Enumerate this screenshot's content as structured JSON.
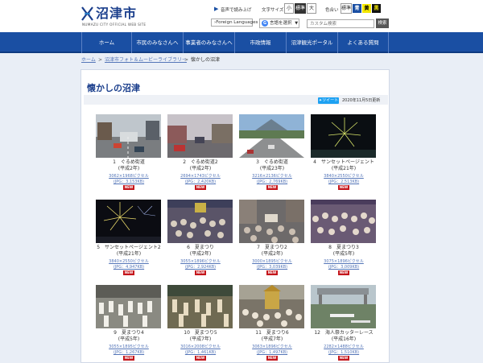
{
  "header": {
    "logo_name": "沼津市",
    "logo_sub": "NUMAZU CITY OFFICIAL WEB SITE",
    "read_aloud": "音声で読み上げ",
    "font_size_label": "文字サイズ",
    "font_small": "小",
    "font_standard": "標準",
    "font_large": "大",
    "color_label": "色合い",
    "color_standard": "標準",
    "color_blue": "青",
    "color_yellow": "黄",
    "color_black": "黒",
    "foreign_languages": "›Foreign Languages",
    "language_select": "言語を選択",
    "search_placeholder": "カスタム検索",
    "search_button": "検索"
  },
  "nav": [
    {
      "label": "ホーム"
    },
    {
      "label": "市民のみなさんへ"
    },
    {
      "label": "事業者のみなさんへ"
    },
    {
      "label": "市政情報"
    },
    {
      "label": "沼津観光ポータル"
    },
    {
      "label": "よくある質問"
    }
  ],
  "breadcrumb": {
    "home": "ホーム",
    "sep1": ">",
    "library": "沼津市フォト＆ムービーライブラリー",
    "sep2": ">",
    "current": "懐かしの沼津"
  },
  "page": {
    "title": "懐かしの沼津",
    "tweet": "ツイート",
    "date": "2020年11月5日更新"
  },
  "photos": [
    {
      "title": "1　ぐるめ街道",
      "era": "(平成2年)",
      "dim": "3062×1968ピクセル",
      "file": "(JPG：3,153KB)",
      "badge": "NEW",
      "scene": "street"
    },
    {
      "title": "2　ぐるめ街道2",
      "era": "(平成2年)",
      "dim": "2694×1743ピクセル",
      "file": "(JPG：2,420KB)",
      "badge": "NEW",
      "scene": "street2"
    },
    {
      "title": "3　ぐるめ街道",
      "era": "(平成23年)",
      "dim": "3216×2136ピクセル",
      "file": "(JPG：2,769KB)",
      "badge": "NEW",
      "scene": "road"
    },
    {
      "title": "4　サンセットページェント",
      "era": "(平成21年)",
      "dim": "3840×2550ピクセル",
      "file": "(JPG：2,513KB)",
      "badge": "NEW",
      "scene": "fireworks"
    },
    {
      "title": "5　サンセットページェント2",
      "era": "(平成21年)",
      "dim": "3840×2550ピクセル",
      "file": "(JPG：4,947KB)",
      "badge": "NEW",
      "scene": "fireworks2"
    },
    {
      "title": "6　夏まつり",
      "era": "(平成2年)",
      "dim": "3055×1896ピクセル",
      "file": "(JPG：2,924KB)",
      "badge": "NEW",
      "scene": "crowd"
    },
    {
      "title": "7　夏まつり2",
      "era": "(平成2年)",
      "dim": "3000×1895ピクセル",
      "file": "(JPG：3,039KB)",
      "badge": "NEW",
      "scene": "crowd2"
    },
    {
      "title": "8　夏まつり3",
      "era": "(平成5年)",
      "dim": "3075×1896ピクセル",
      "file": "(JPG：3,009KB)",
      "badge": "NEW",
      "scene": "crowd3"
    },
    {
      "title": "9　夏まつり4",
      "era": "(平成5年)",
      "dim": "3055×1895ピクセル",
      "file": "(JPG：1,267KB)",
      "badge": "NEW",
      "scene": "parade"
    },
    {
      "title": "10　夏まつり5",
      "era": "(平成7年)",
      "dim": "3016×2008ピクセル",
      "file": "(JPG：1,461KB)",
      "badge": "NEW",
      "scene": "parade2"
    },
    {
      "title": "11　夏まつり6",
      "era": "(平成7年)",
      "dim": "3063×1896ピクセル",
      "file": "(JPG：1,497KB)",
      "badge": "NEW",
      "scene": "parade3"
    },
    {
      "title": "12　海人祭カッターレース",
      "era": "(平成16年)",
      "dim": "2282×1488ピクセル",
      "file": "(JPG：1,510KB)",
      "badge": "NEW",
      "scene": "harbor"
    }
  ],
  "colors": {
    "nav": "#1a4fa3",
    "title": "#1a3e8c",
    "link": "#5576b8",
    "badge": "#c4161c",
    "color_blue": "#1a4fa3",
    "color_yellow": "#f2e600",
    "color_black": "#111111"
  }
}
